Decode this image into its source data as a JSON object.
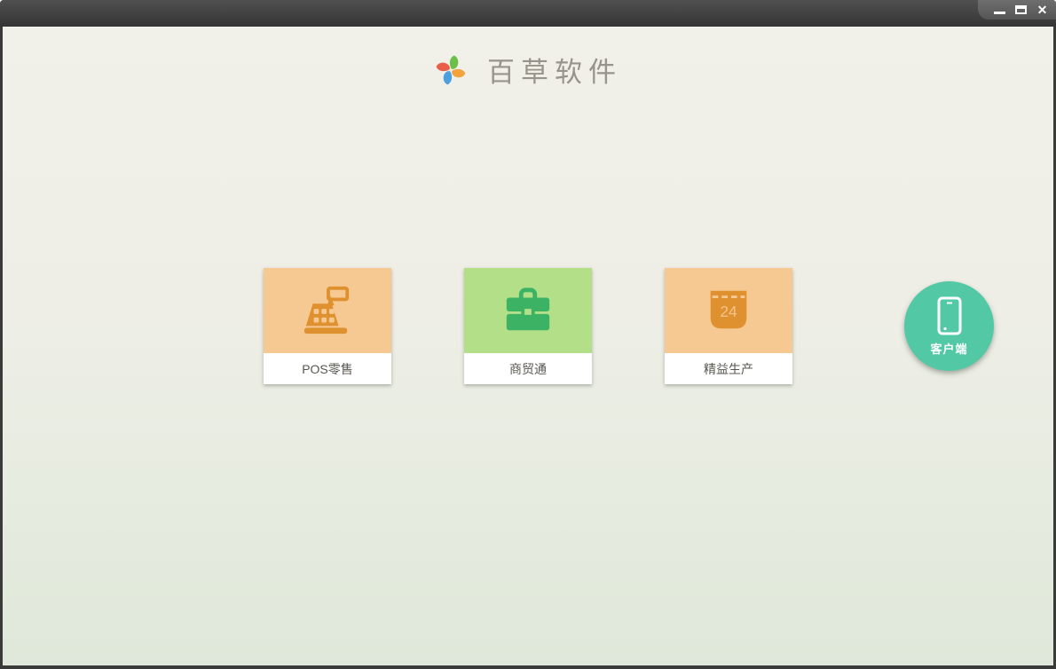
{
  "window": {
    "controls": {
      "minimize_label": "minimize",
      "maximize_label": "maximize",
      "close_glyph": "✕"
    },
    "titlebar_color": "#424242"
  },
  "header": {
    "app_title": "百草软件",
    "title_color": "#97948a",
    "logo_petal_colors": {
      "top": "#6cc04a",
      "right": "#f2a33c",
      "bottom": "#4e9fdf",
      "left": "#e9604a"
    }
  },
  "products": [
    {
      "label": "POS零售",
      "icon": "cash-register-icon",
      "tile_color": "#f6c992",
      "icon_color": "#e0912f"
    },
    {
      "label": "商贸通",
      "icon": "briefcase-icon",
      "tile_color": "#b3df88",
      "icon_color": "#3cb364"
    },
    {
      "label": "精益生产",
      "icon": "calendar-icon",
      "tile_color": "#f6c992",
      "icon_color": "#e0912f",
      "calendar_day": "24"
    }
  ],
  "client_button": {
    "label": "客户端",
    "color": "#52c9a4",
    "icon": "smartphone-icon"
  },
  "background": {
    "top_color": "#f1f0e9",
    "bottom_color": "#dfe8da"
  }
}
